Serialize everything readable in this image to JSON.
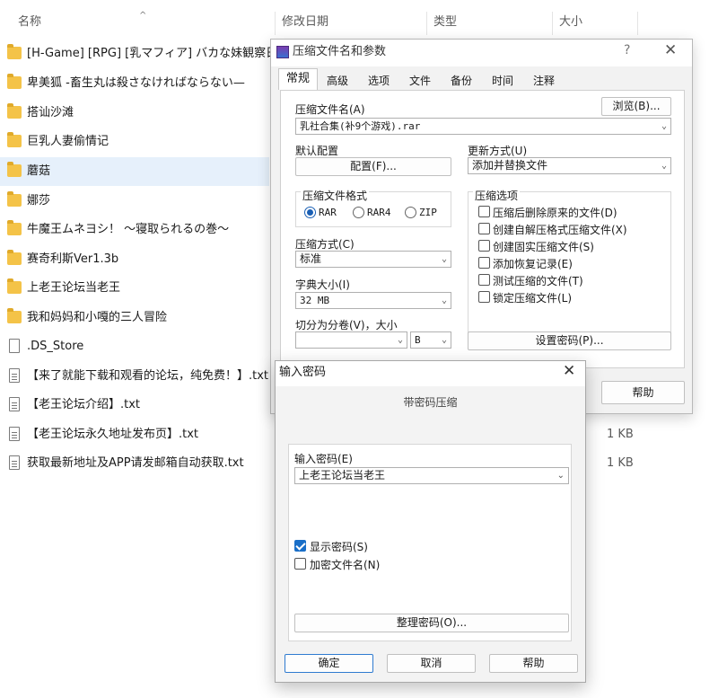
{
  "explorer": {
    "columns": {
      "name": "名称",
      "modified": "修改日期",
      "type": "类型",
      "size": "大小"
    },
    "rows": [
      {
        "name": "[H-Game] [RPG] [乳マフィア] バカな妹観察日...",
        "kind": "folder",
        "size": ""
      },
      {
        "name": "卑美狐 -畜生丸は殺さなければならない—",
        "kind": "folder",
        "size": ""
      },
      {
        "name": "搭讪沙滩",
        "kind": "folder",
        "size": ""
      },
      {
        "name": "巨乳人妻偷情记",
        "kind": "folder",
        "size": ""
      },
      {
        "name": "蘑菇",
        "kind": "folder",
        "size": "",
        "selected": true
      },
      {
        "name": "娜莎",
        "kind": "folder",
        "size": ""
      },
      {
        "name": "牛魔王ムネヨシ！ ～寝取られるの巻～",
        "kind": "folder",
        "size": ""
      },
      {
        "name": "赛奇利斯Ver1.3b",
        "kind": "folder",
        "size": ""
      },
      {
        "name": "上老王论坛当老王",
        "kind": "folder",
        "size": ""
      },
      {
        "name": "我和妈妈和小嘎的三人冒险",
        "kind": "folder",
        "size": ""
      },
      {
        "name": ".DS_Store",
        "kind": "file",
        "size": ""
      },
      {
        "name": "【来了就能下载和观看的论坛，纯免费！】.txt",
        "kind": "txt",
        "size": ""
      },
      {
        "name": "【老王论坛介绍】.txt",
        "kind": "txt",
        "size": ""
      },
      {
        "name": "【老王论坛永久地址发布页】.txt",
        "kind": "txt",
        "size": "1 KB"
      },
      {
        "name": "获取最新地址及APP请发邮箱自动获取.txt",
        "kind": "txt",
        "size": "1 KB"
      }
    ]
  },
  "archive_dialog": {
    "title": "压缩文件名和参数",
    "help_q": "?",
    "close": "✕",
    "tabs": [
      "常规",
      "高级",
      "选项",
      "文件",
      "备份",
      "时间",
      "注释"
    ],
    "archive_name_label": "压缩文件名(A)",
    "archive_name_value": "乳社合集(补9个游戏).rar",
    "browse_button": "浏览(B)...",
    "default_profile_label": "默认配置",
    "profile_button": "配置(F)...",
    "update_mode_label": "更新方式(U)",
    "update_mode_value": "添加并替换文件",
    "format_group_label": "压缩文件格式",
    "formats": [
      {
        "label": "RAR",
        "selected": true
      },
      {
        "label": "RAR4",
        "selected": false
      },
      {
        "label": "ZIP",
        "selected": false
      }
    ],
    "options_group_label": "压缩选项",
    "options": [
      {
        "label": "压缩后删除原来的文件(D)",
        "checked": false
      },
      {
        "label": "创建自解压格式压缩文件(X)",
        "checked": false
      },
      {
        "label": "创建固实压缩文件(S)",
        "checked": false
      },
      {
        "label": "添加恢复记录(E)",
        "checked": false
      },
      {
        "label": "测试压缩的文件(T)",
        "checked": false
      },
      {
        "label": "锁定压缩文件(L)",
        "checked": false
      }
    ],
    "method_label": "压缩方式(C)",
    "method_value": "标准",
    "dict_label": "字典大小(I)",
    "dict_value": "32 MB",
    "split_label": "切分为分卷(V)，大小",
    "split_value": "",
    "split_unit": "B",
    "set_password_button": "设置密码(P)...",
    "help_button": "帮助"
  },
  "password_dialog": {
    "title": "输入密码",
    "close": "✕",
    "subtitle": "带密码压缩",
    "password_label": "输入密码(E)",
    "password_value": "上老王论坛当老王",
    "show_password_label": "显示密码(S)",
    "show_password_checked": true,
    "encrypt_names_label": "加密文件名(N)",
    "encrypt_names_checked": false,
    "organize_button": "整理密码(O)...",
    "ok_button": "确定",
    "cancel_button": "取消",
    "help_button": "帮助"
  }
}
